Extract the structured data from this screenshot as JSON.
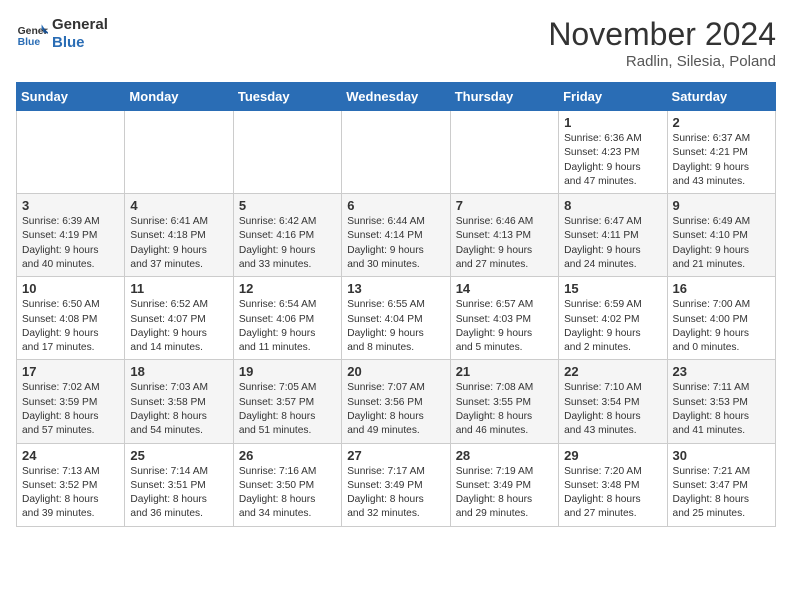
{
  "header": {
    "logo_text_general": "General",
    "logo_text_blue": "Blue",
    "month_title": "November 2024",
    "subtitle": "Radlin, Silesia, Poland"
  },
  "days_of_week": [
    "Sunday",
    "Monday",
    "Tuesday",
    "Wednesday",
    "Thursday",
    "Friday",
    "Saturday"
  ],
  "weeks": [
    [
      {
        "day": "",
        "info": ""
      },
      {
        "day": "",
        "info": ""
      },
      {
        "day": "",
        "info": ""
      },
      {
        "day": "",
        "info": ""
      },
      {
        "day": "",
        "info": ""
      },
      {
        "day": "1",
        "info": "Sunrise: 6:36 AM\nSunset: 4:23 PM\nDaylight: 9 hours\nand 47 minutes."
      },
      {
        "day": "2",
        "info": "Sunrise: 6:37 AM\nSunset: 4:21 PM\nDaylight: 9 hours\nand 43 minutes."
      }
    ],
    [
      {
        "day": "3",
        "info": "Sunrise: 6:39 AM\nSunset: 4:19 PM\nDaylight: 9 hours\nand 40 minutes."
      },
      {
        "day": "4",
        "info": "Sunrise: 6:41 AM\nSunset: 4:18 PM\nDaylight: 9 hours\nand 37 minutes."
      },
      {
        "day": "5",
        "info": "Sunrise: 6:42 AM\nSunset: 4:16 PM\nDaylight: 9 hours\nand 33 minutes."
      },
      {
        "day": "6",
        "info": "Sunrise: 6:44 AM\nSunset: 4:14 PM\nDaylight: 9 hours\nand 30 minutes."
      },
      {
        "day": "7",
        "info": "Sunrise: 6:46 AM\nSunset: 4:13 PM\nDaylight: 9 hours\nand 27 minutes."
      },
      {
        "day": "8",
        "info": "Sunrise: 6:47 AM\nSunset: 4:11 PM\nDaylight: 9 hours\nand 24 minutes."
      },
      {
        "day": "9",
        "info": "Sunrise: 6:49 AM\nSunset: 4:10 PM\nDaylight: 9 hours\nand 21 minutes."
      }
    ],
    [
      {
        "day": "10",
        "info": "Sunrise: 6:50 AM\nSunset: 4:08 PM\nDaylight: 9 hours\nand 17 minutes."
      },
      {
        "day": "11",
        "info": "Sunrise: 6:52 AM\nSunset: 4:07 PM\nDaylight: 9 hours\nand 14 minutes."
      },
      {
        "day": "12",
        "info": "Sunrise: 6:54 AM\nSunset: 4:06 PM\nDaylight: 9 hours\nand 11 minutes."
      },
      {
        "day": "13",
        "info": "Sunrise: 6:55 AM\nSunset: 4:04 PM\nDaylight: 9 hours\nand 8 minutes."
      },
      {
        "day": "14",
        "info": "Sunrise: 6:57 AM\nSunset: 4:03 PM\nDaylight: 9 hours\nand 5 minutes."
      },
      {
        "day": "15",
        "info": "Sunrise: 6:59 AM\nSunset: 4:02 PM\nDaylight: 9 hours\nand 2 minutes."
      },
      {
        "day": "16",
        "info": "Sunrise: 7:00 AM\nSunset: 4:00 PM\nDaylight: 9 hours\nand 0 minutes."
      }
    ],
    [
      {
        "day": "17",
        "info": "Sunrise: 7:02 AM\nSunset: 3:59 PM\nDaylight: 8 hours\nand 57 minutes."
      },
      {
        "day": "18",
        "info": "Sunrise: 7:03 AM\nSunset: 3:58 PM\nDaylight: 8 hours\nand 54 minutes."
      },
      {
        "day": "19",
        "info": "Sunrise: 7:05 AM\nSunset: 3:57 PM\nDaylight: 8 hours\nand 51 minutes."
      },
      {
        "day": "20",
        "info": "Sunrise: 7:07 AM\nSunset: 3:56 PM\nDaylight: 8 hours\nand 49 minutes."
      },
      {
        "day": "21",
        "info": "Sunrise: 7:08 AM\nSunset: 3:55 PM\nDaylight: 8 hours\nand 46 minutes."
      },
      {
        "day": "22",
        "info": "Sunrise: 7:10 AM\nSunset: 3:54 PM\nDaylight: 8 hours\nand 43 minutes."
      },
      {
        "day": "23",
        "info": "Sunrise: 7:11 AM\nSunset: 3:53 PM\nDaylight: 8 hours\nand 41 minutes."
      }
    ],
    [
      {
        "day": "24",
        "info": "Sunrise: 7:13 AM\nSunset: 3:52 PM\nDaylight: 8 hours\nand 39 minutes."
      },
      {
        "day": "25",
        "info": "Sunrise: 7:14 AM\nSunset: 3:51 PM\nDaylight: 8 hours\nand 36 minutes."
      },
      {
        "day": "26",
        "info": "Sunrise: 7:16 AM\nSunset: 3:50 PM\nDaylight: 8 hours\nand 34 minutes."
      },
      {
        "day": "27",
        "info": "Sunrise: 7:17 AM\nSunset: 3:49 PM\nDaylight: 8 hours\nand 32 minutes."
      },
      {
        "day": "28",
        "info": "Sunrise: 7:19 AM\nSunset: 3:49 PM\nDaylight: 8 hours\nand 29 minutes."
      },
      {
        "day": "29",
        "info": "Sunrise: 7:20 AM\nSunset: 3:48 PM\nDaylight: 8 hours\nand 27 minutes."
      },
      {
        "day": "30",
        "info": "Sunrise: 7:21 AM\nSunset: 3:47 PM\nDaylight: 8 hours\nand 25 minutes."
      }
    ]
  ]
}
